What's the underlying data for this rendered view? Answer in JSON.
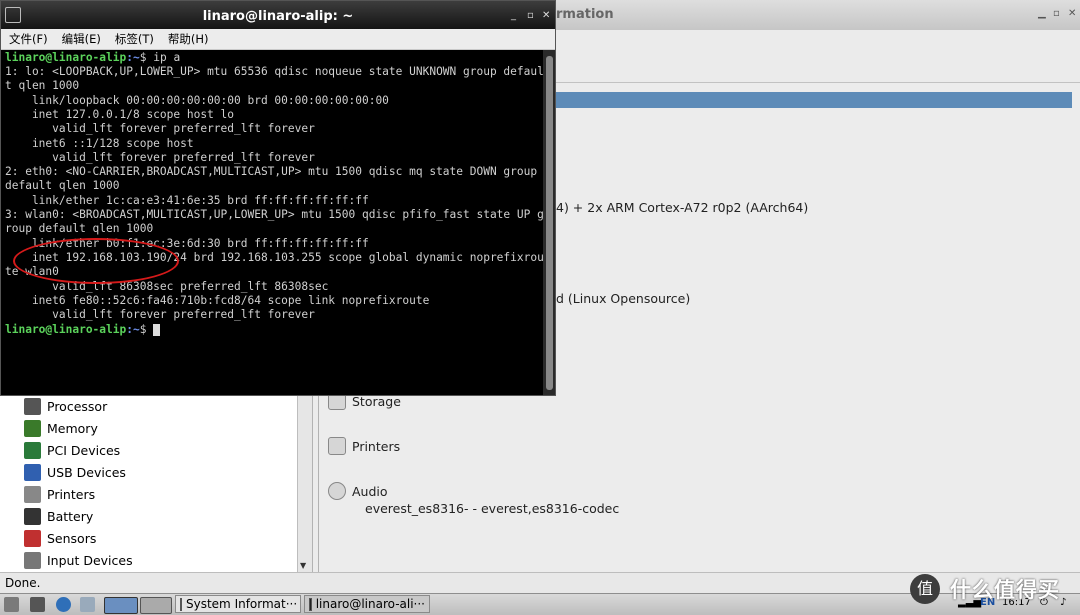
{
  "sysinfo": {
    "title_fragment": "rmation",
    "header_bar_color": "#5d8bb8",
    "cpu_text": "4) + 2x ARM Cortex-A72 r0p2 (AArch64)",
    "os_text": "d (Linux Opensource)",
    "tree_items": [
      {
        "label": "Processor",
        "icon": "processor-icon"
      },
      {
        "label": "Memory",
        "icon": "memory-icon"
      },
      {
        "label": "PCI Devices",
        "icon": "pci-devices-icon"
      },
      {
        "label": "USB Devices",
        "icon": "usb-devices-icon"
      },
      {
        "label": "Printers",
        "icon": "printer-icon"
      },
      {
        "label": "Battery",
        "icon": "battery-icon"
      },
      {
        "label": "Sensors",
        "icon": "thermometer-icon"
      },
      {
        "label": "Input Devices",
        "icon": "input-devices-icon"
      }
    ],
    "sections": {
      "storage": "Storage",
      "printers": "Printers",
      "audio": "Audio",
      "audio_device": "everest_es8316- - everest,es8316-codec"
    },
    "status": "Done."
  },
  "terminal": {
    "title": "linaro@linaro-alip: ~",
    "menus": [
      "文件(F)",
      "编辑(E)",
      "标签(T)",
      "帮助(H)"
    ],
    "prompt_user": "linaro@linaro-alip",
    "prompt_path": ":~",
    "prompt_sign": "$",
    "command": "ip a",
    "output_lines": [
      "1: lo: <LOOPBACK,UP,LOWER_UP> mtu 65536 qdisc noqueue state UNKNOWN group defaul",
      "t qlen 1000",
      "    link/loopback 00:00:00:00:00:00 brd 00:00:00:00:00:00",
      "    inet 127.0.0.1/8 scope host lo",
      "       valid_lft forever preferred_lft forever",
      "    inet6 ::1/128 scope host",
      "       valid_lft forever preferred_lft forever",
      "2: eth0: <NO-CARRIER,BROADCAST,MULTICAST,UP> mtu 1500 qdisc mq state DOWN group",
      "default qlen 1000",
      "    link/ether 1c:ca:e3:41:6e:35 brd ff:ff:ff:ff:ff:ff",
      "3: wlan0: <BROADCAST,MULTICAST,UP,LOWER_UP> mtu 1500 qdisc pfifo_fast state UP g",
      "roup default qlen 1000",
      "    link/ether b0:f1:ec:3e:6d:30 brd ff:ff:ff:ff:ff:ff",
      "    inet 192.168.103.190/24 brd 192.168.103.255 scope global dynamic noprefixrou",
      "te wlan0",
      "       valid_lft 86308sec preferred_lft 86308sec",
      "    inet6 fe80::52c6:fa46:710b:fcd8/64 scope link noprefixroute",
      "       valid_lft forever preferred_lft forever"
    ],
    "highlight_color": "#d61a1a"
  },
  "taskbar": {
    "tasks": [
      {
        "label": "System Informat···"
      },
      {
        "label": "linaro@linaro-ali···"
      }
    ],
    "tray_lang": "EN",
    "clock": "16:17"
  },
  "watermark": {
    "logo": "值",
    "text": "什么值得买"
  }
}
